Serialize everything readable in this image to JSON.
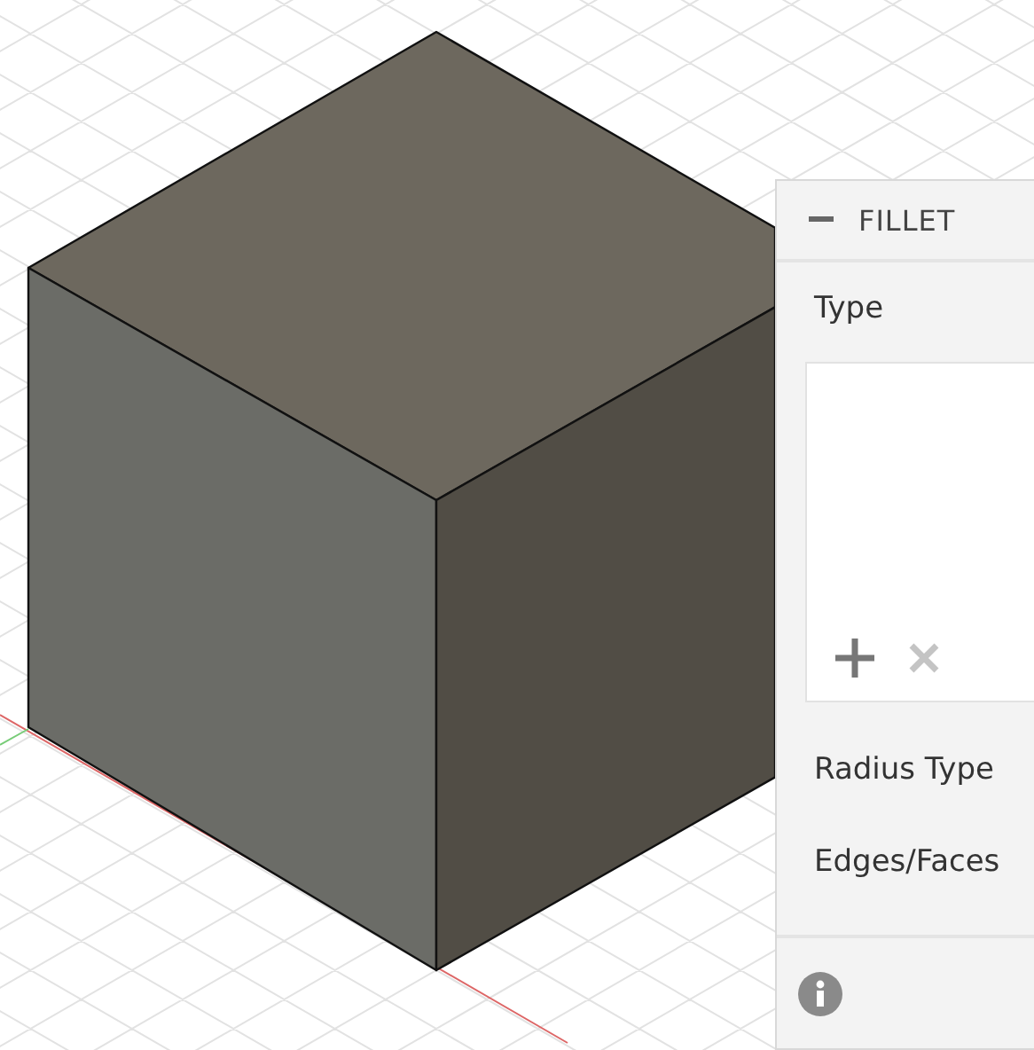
{
  "dialog": {
    "title": "FILLET",
    "expanded": true,
    "rows": [
      {
        "kind": "label",
        "label": "Type"
      },
      {
        "kind": "list",
        "buttons": [
          {
            "kind": "add",
            "disabled": false
          },
          {
            "kind": "remove",
            "disabled": true
          }
        ]
      },
      {
        "kind": "label",
        "label": "Radius Type"
      },
      {
        "kind": "label",
        "label": "Edges/Faces"
      }
    ]
  }
}
